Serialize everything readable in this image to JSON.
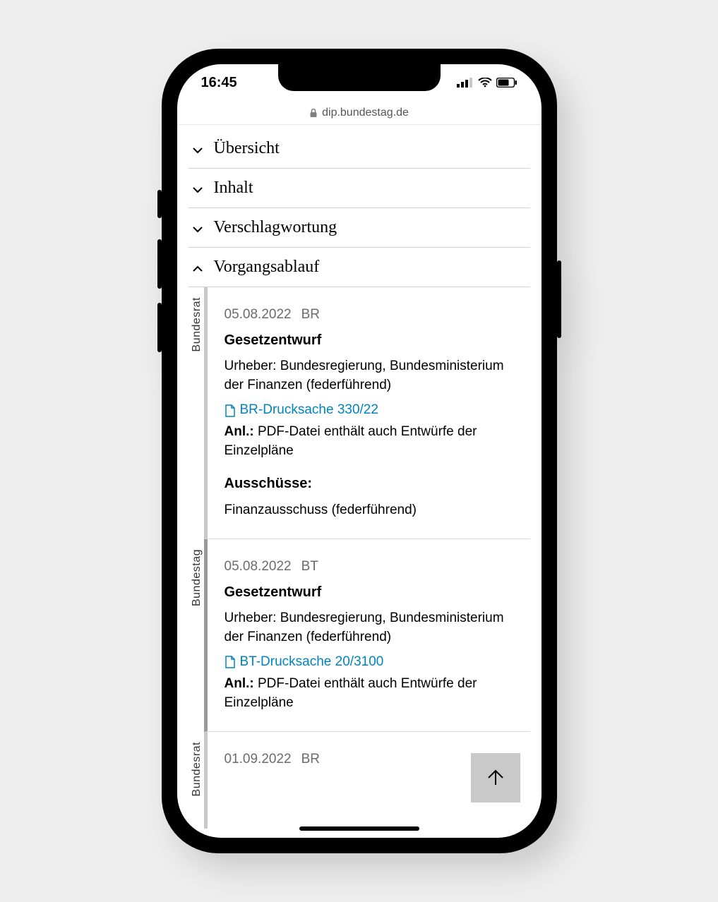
{
  "status": {
    "time": "16:45"
  },
  "url": {
    "host": "dip.bundestag.de"
  },
  "accordion": [
    {
      "label": "Übersicht",
      "expanded": false
    },
    {
      "label": "Inhalt",
      "expanded": false
    },
    {
      "label": "Verschlagwortung",
      "expanded": false
    },
    {
      "label": "Vorgangsablauf",
      "expanded": true
    }
  ],
  "entries": [
    {
      "side_label": "Bundesrat",
      "date": "05.08.2022",
      "chamber": "BR",
      "title": "Gesetzentwurf",
      "author": "Urheber: Bundesregierung, Bundesministerium der Finanzen (federführend)",
      "doc_link": "BR-Drucksache 330/22",
      "annex_label": "Anl.:",
      "annex_text": "PDF-Datei enthält auch Entwürfe der Einzelpläne",
      "committees_label": "Ausschüsse:",
      "committees": "Finanzausschuss (federführend)"
    },
    {
      "side_label": "Bundestag",
      "date": "05.08.2022",
      "chamber": "BT",
      "title": "Gesetzentwurf",
      "author": "Urheber: Bundesregierung, Bundesministerium der Finanzen (federführend)",
      "doc_link": "BT-Drucksache 20/3100",
      "annex_label": "Anl.:",
      "annex_text": "PDF-Datei enthält auch Entwürfe der Einzelpläne"
    },
    {
      "side_label": "Bundesrat",
      "date": "01.09.2022",
      "chamber": "BR"
    }
  ]
}
